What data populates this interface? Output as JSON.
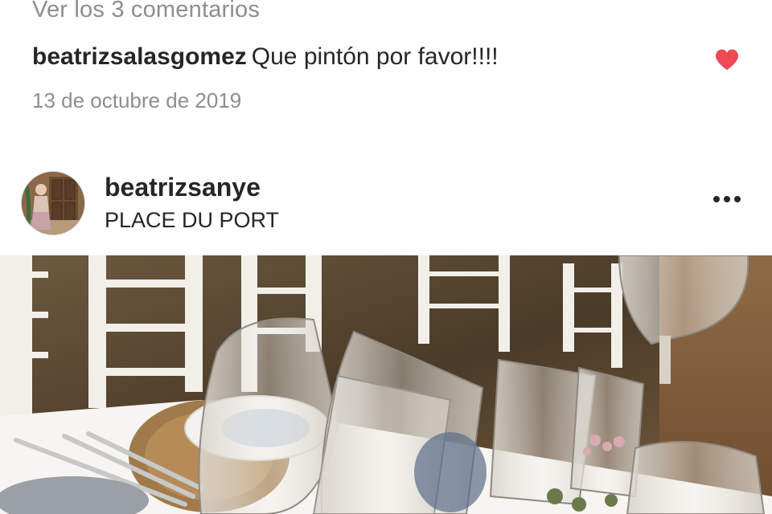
{
  "comments": {
    "view_all_label": "Ver los 3 comentarios",
    "latest": {
      "username": "beatrizsalasgomez",
      "text": "Que pintón por favor!!!!",
      "liked": true
    },
    "date": "13 de octubre de 2019"
  },
  "next_post": {
    "username": "beatrizsanye",
    "location": "PLACE DU PORT",
    "avatar_icon": "profile-photo",
    "more_icon": "more-options-icon"
  },
  "colors": {
    "text_primary": "#262626",
    "text_secondary": "#8e8e8e",
    "like_red": "#ed4956"
  }
}
